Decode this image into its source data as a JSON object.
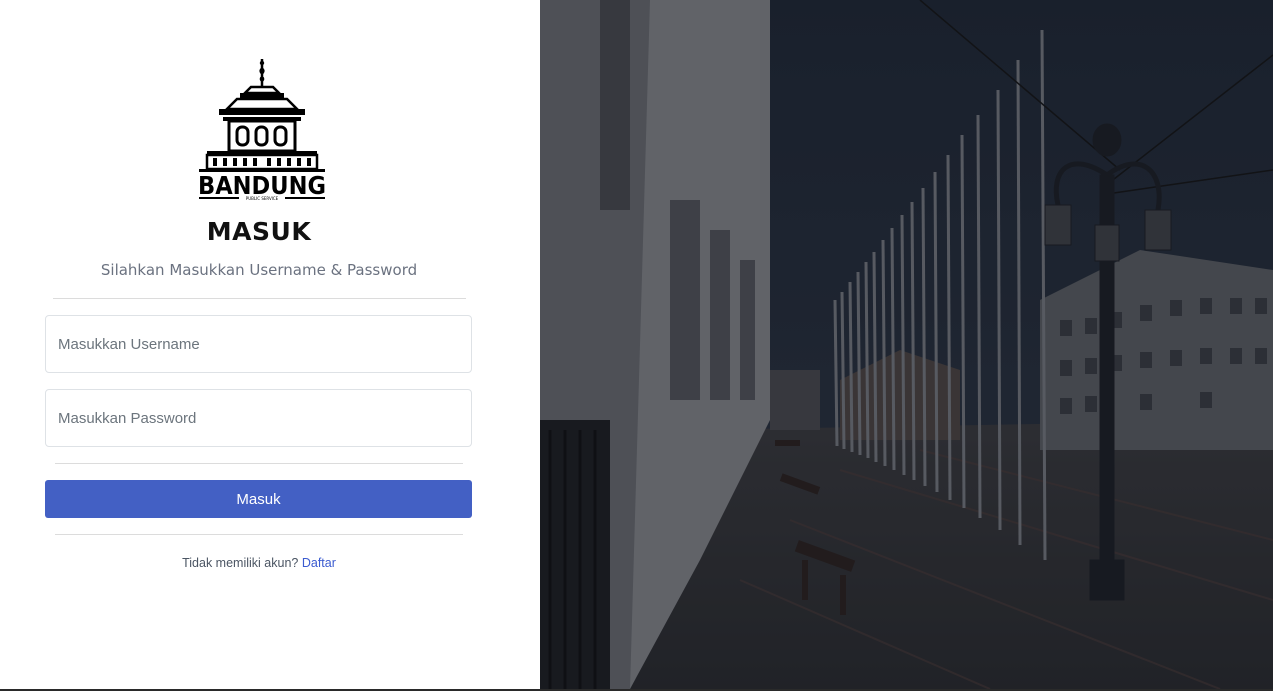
{
  "brand": {
    "logo_text": "BANDUNG",
    "logo_subtext": "PUBLIC SERVICE"
  },
  "login": {
    "title": "MASUK",
    "subtitle": "Silahkan Masukkan Username & Password",
    "username_placeholder": "Masukkan Username",
    "username_value": "",
    "password_placeholder": "Masukkan Password",
    "password_value": "",
    "submit_label": "Masuk",
    "no_account_text": "Tidak memiliki akun?",
    "register_label": "Daftar"
  },
  "colors": {
    "accent": "#4360c4",
    "link": "#3b5bd0",
    "photo_overlay": "#1b2230"
  },
  "icons": {
    "logo": "bandung-gedung-sate-logo"
  }
}
